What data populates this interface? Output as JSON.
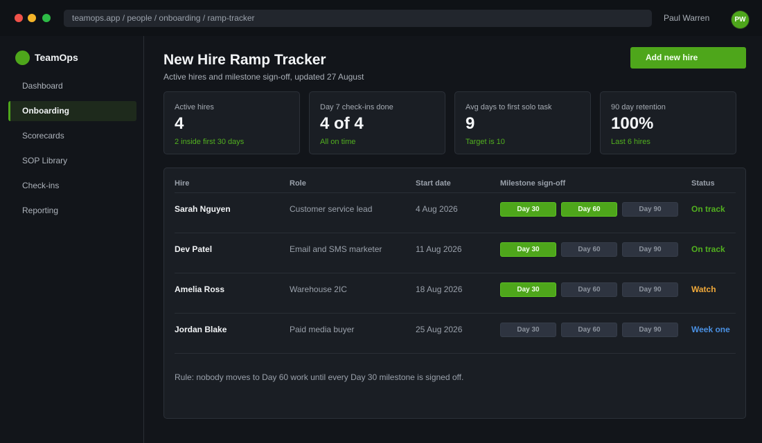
{
  "browser": {
    "url": "teamops.app / people / onboarding / ramp-tracker",
    "user_name": "Paul Warren",
    "user_initials": "PW"
  },
  "sidebar": {
    "brand": "TeamOps",
    "items": [
      {
        "label": "Dashboard",
        "active": false
      },
      {
        "label": "Onboarding",
        "active": true
      },
      {
        "label": "Scorecards",
        "active": false
      },
      {
        "label": "SOP Library",
        "active": false
      },
      {
        "label": "Check-ins",
        "active": false
      },
      {
        "label": "Reporting",
        "active": false
      }
    ]
  },
  "header": {
    "title": "New Hire Ramp Tracker",
    "subtitle": "Active hires and milestone sign-off, updated 27 August",
    "add_button": "Add new hire"
  },
  "stats": [
    {
      "label": "Active hires",
      "value": "4",
      "note": "2 inside first 30 days"
    },
    {
      "label": "Day 7 check-ins done",
      "value": "4 of 4",
      "note": "All on time"
    },
    {
      "label": "Avg days to first solo task",
      "value": "9",
      "note": "Target is 10"
    },
    {
      "label": "90 day retention",
      "value": "100%",
      "note": "Last 6 hires"
    }
  ],
  "table": {
    "columns": [
      "Hire",
      "Role",
      "Start date",
      "Milestone sign-off",
      "Status"
    ],
    "milestones": [
      "Day 30",
      "Day 60",
      "Day 90"
    ],
    "rows": [
      {
        "name": "Sarah Nguyen",
        "role": "Customer service lead",
        "start": "4 Aug 2026",
        "signed": [
          true,
          true,
          false
        ],
        "status": "On track"
      },
      {
        "name": "Dev Patel",
        "role": "Email and SMS marketer",
        "start": "11 Aug 2026",
        "signed": [
          true,
          false,
          false
        ],
        "status": "On track"
      },
      {
        "name": "Amelia Ross",
        "role": "Warehouse 2IC",
        "start": "18 Aug 2026",
        "signed": [
          true,
          false,
          false
        ],
        "status": "Watch"
      },
      {
        "name": "Jordan Blake",
        "role": "Paid media buyer",
        "start": "25 Aug 2026",
        "signed": [
          false,
          false,
          false
        ],
        "status": "Week one"
      }
    ],
    "rule": "Rule: nobody moves to Day 60 work until every Day 30 milestone is signed off."
  },
  "colors": {
    "accent": "#4ea61b",
    "status_on_track": "#52b01f",
    "status_watch": "#f0a93a",
    "status_week_one": "#4a90e2"
  }
}
